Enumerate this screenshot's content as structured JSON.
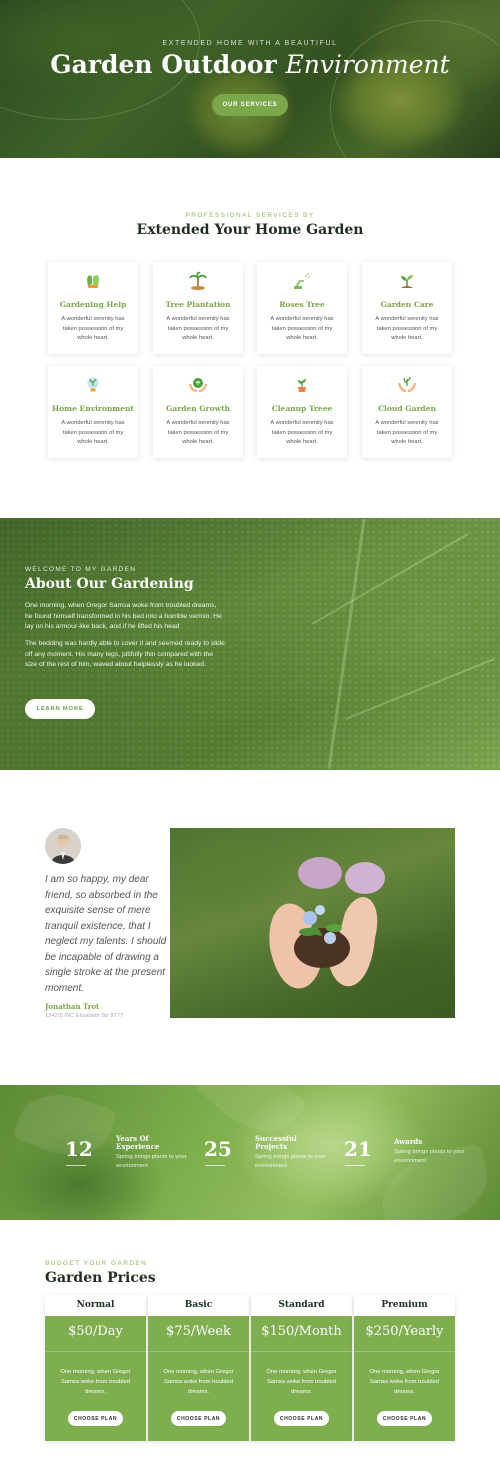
{
  "hero": {
    "subtitle": "Extended Home With A Beautiful",
    "title_main": "Garden Outdoor",
    "title_italic": "Environment",
    "button": "Our Services"
  },
  "services": {
    "subtitle": "Professional Services By",
    "title": "Extended Your Home Garden",
    "items": [
      {
        "title": "Gardening Help",
        "desc": "A wonderful serenity has taken possession of my whole heart.",
        "icon": "gloves-icon"
      },
      {
        "title": "Tree Plantation",
        "desc": "A wonderful serenity has taken possession of my whole heart.",
        "icon": "palm-tree-icon"
      },
      {
        "title": "Roses Tree",
        "desc": "A wonderful serenity has taken possession of my whole heart.",
        "icon": "watering-can-icon"
      },
      {
        "title": "Garden Care",
        "desc": "A wonderful serenity has taken possession of my whole heart.",
        "icon": "sprout-icon"
      },
      {
        "title": "Home Environment",
        "desc": "A wonderful serenity has taken possession of my whole heart.",
        "icon": "bulb-plant-icon"
      },
      {
        "title": "Garden Growth",
        "desc": "A wonderful serenity has taken possession of my whole heart.",
        "icon": "hands-globe-icon"
      },
      {
        "title": "Cleanup Treee",
        "desc": "A wonderful serenity has taken possession of my whole heart.",
        "icon": "potted-plant-icon"
      },
      {
        "title": "Cloud Garden",
        "desc": "A wonderful serenity has taken possession of my whole heart.",
        "icon": "hands-plant-icon"
      }
    ]
  },
  "about": {
    "subtitle": "Welcome To My Garden",
    "title": "About Our Gardening",
    "para1": "One morning, when Gregor Samsa woke from troubled dreams, he found himself transformed in his bed into a horrible vermin. He lay on his armour-like back, and if he lifted his head",
    "para2": "The bedding was hardly able to cover it and seemed ready to slide off any moment. His many legs, pitifully thin compared with the size of the rest of him, waved about helplessly as he looked.",
    "button": "Learn More"
  },
  "testimonial": {
    "quote": "I am so happy, my dear friend, so absorbed in the exquisite sense of mere tranquil existence, that I neglect my talents. I should be incapable of drawing a single stroke at the present moment.",
    "name": "Jonathan Trot",
    "address": "1342/5 INC Elizabeth Str 8777"
  },
  "stats": [
    {
      "number": "12",
      "label1": "Years Of",
      "label2": "Experience",
      "desc": "Spring brings plants to your environment"
    },
    {
      "number": "25",
      "label1": "Successful",
      "label2": "Projects",
      "desc": "Spring brings plants to your environment"
    },
    {
      "number": "21",
      "label1": "Awards",
      "label2": "",
      "desc": "Spring brings plants to your environment"
    }
  ],
  "prices": {
    "subtitle": "Budget Your Garden",
    "title": "Garden Prices",
    "plans": [
      {
        "name": "Normal",
        "price": "$50/Day",
        "desc": "One morning, when Gregor Samsa woke from troubled dreams.",
        "button": "Choose Plan"
      },
      {
        "name": "Basic",
        "price": "$75/Week",
        "desc": "One morning, when Gregor Samsa woke from troubled dreams.",
        "button": "Choose Plan"
      },
      {
        "name": "Standard",
        "price": "$150/Month",
        "desc": "One morning, when Gregor Samsa woke from troubled dreams.",
        "button": "Choose Plan"
      },
      {
        "name": "Premium",
        "price": "$250/Yearly",
        "desc": "One morning, when Gregor Samsa woke from troubled dreams.",
        "button": "Choose Plan"
      }
    ]
  },
  "colors": {
    "accent": "#7aa84a",
    "heading": "#1f2f1f"
  }
}
